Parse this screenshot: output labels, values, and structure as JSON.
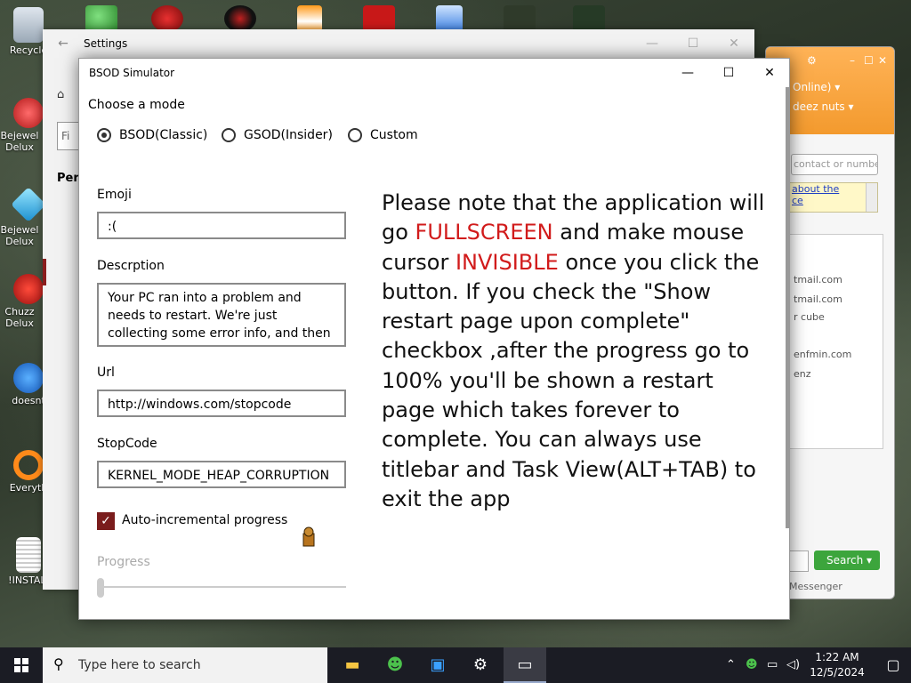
{
  "desktop": {
    "icons": [
      {
        "label": "Recycle"
      },
      {
        "label": "Bejewel Delux"
      },
      {
        "label": "Bejewel Delux"
      },
      {
        "label": "Chuzz Delux"
      },
      {
        "label": "doesnt"
      },
      {
        "label": "Everyth"
      },
      {
        "label": "!INSTALI"
      }
    ]
  },
  "settings": {
    "title": "Settings",
    "find_placeholder": "Fi",
    "section": "Pers"
  },
  "messenger": {
    "status": "Online) ▾",
    "username": "deez nuts ▾",
    "contact_placeholder": "contact or numbe",
    "note_line1": "about the",
    "note_line2": "ce",
    "contacts": [
      "tmail.com",
      "tmail.com",
      "r cube",
      "enfmin.com",
      "enz"
    ],
    "search_label": "Search",
    "footer": "Messenger"
  },
  "bsod": {
    "title": "BSOD Simulator",
    "heading": "Choose a mode",
    "modes": [
      "BSOD(Classic)",
      "GSOD(Insider)",
      "Custom"
    ],
    "selected_mode": "BSOD(Classic)",
    "emoji_label": "Emoji",
    "emoji_value": ":(",
    "description_label": "Descrption",
    "description_value": "Your PC ran into a problem and needs to restart. We're just collecting some error info, and then we'll restart for you",
    "url_label": "Url",
    "url_value": "http://windows.com/stopcode",
    "stopcode_label": "StopCode",
    "stopcode_value": "KERNEL_MODE_HEAP_CORRUPTION",
    "auto_progress_label": "Auto-incremental progress",
    "auto_progress_checked": true,
    "progress_label": "Progress",
    "progress_value": 0,
    "info_parts": {
      "p1": "Please note that the application will go ",
      "p2": "FULLSCREEN",
      "p3": " and make mouse cursor ",
      "p4": "INVISIBLE",
      "p5": " once you click the button. If you check the \"Show restart page upon complete\" checkbox ,after the progress go to 100% you'll be shown a restart page which takes forever to complete. You can always use titlebar and Task View(ALT+TAB) to exit the app"
    },
    "accent_color": "#d11b1b",
    "checkbox_color": "#7a1c1c"
  },
  "taskbar": {
    "search_placeholder": "Type here to search",
    "time": "1:22 AM",
    "date": "12/5/2024",
    "apps": [
      "file-explorer-icon",
      "messenger-icon",
      "store-icon",
      "settings-icon",
      "bsod-app-icon"
    ]
  }
}
